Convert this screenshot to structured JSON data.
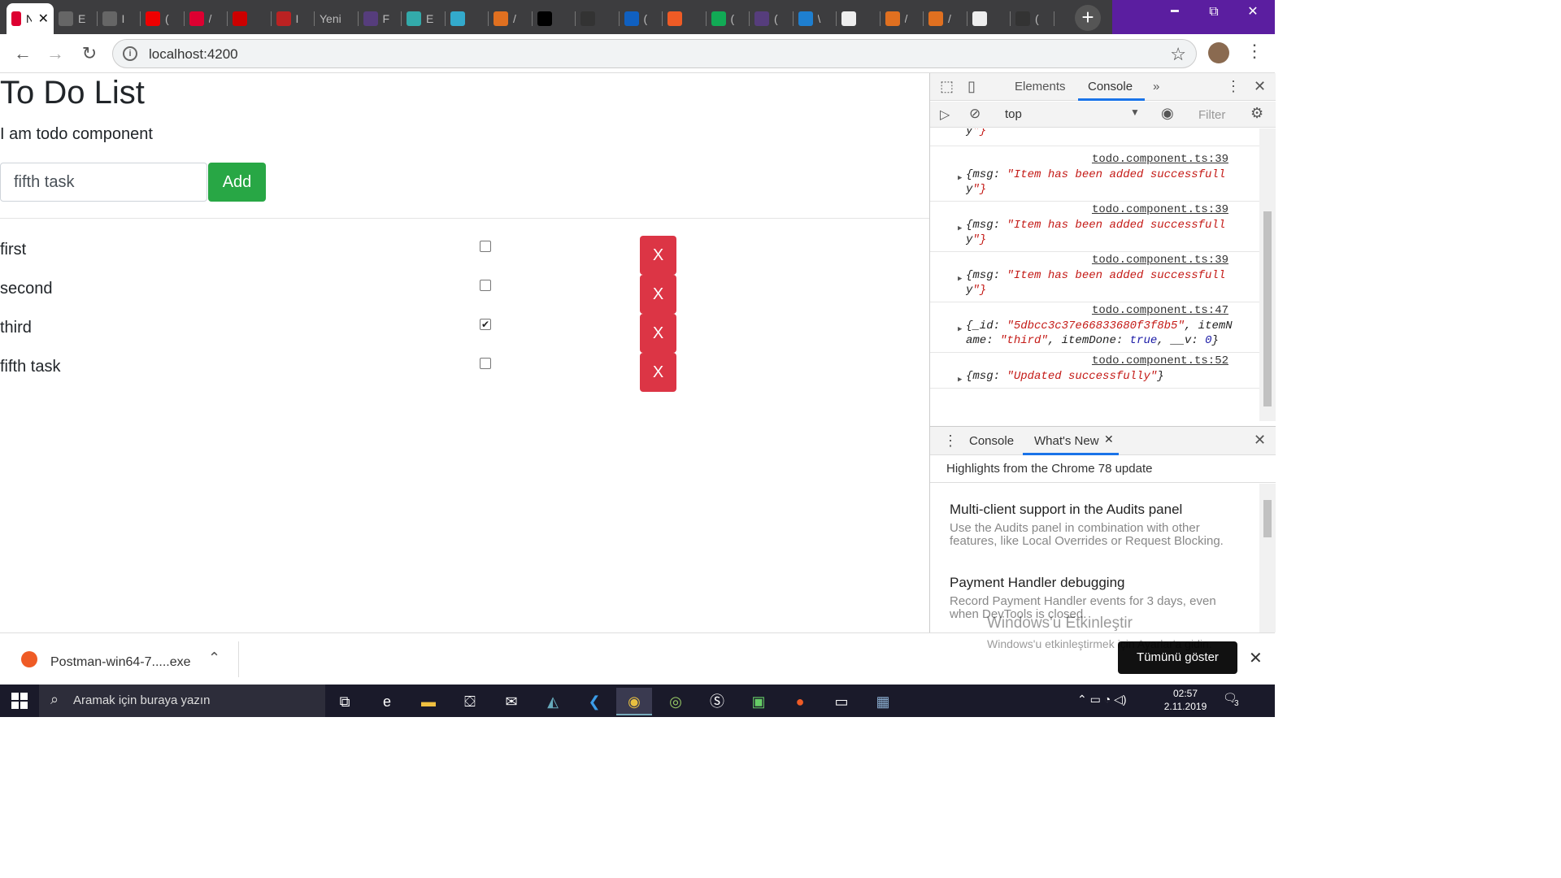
{
  "browser": {
    "tabs": [
      {
        "title": "N",
        "icon": "angular-icon",
        "active": true
      },
      {
        "title": "E",
        "icon": "globe-icon"
      },
      {
        "title": "I",
        "icon": "globe-icon"
      },
      {
        "title": "(",
        "icon": "youtube-icon"
      },
      {
        "title": "/",
        "icon": "angular-logo-icon"
      },
      {
        "title": "",
        "icon": "p-icon"
      },
      {
        "title": "I",
        "icon": "h-icon"
      },
      {
        "title": "Yeni",
        "icon": ""
      },
      {
        "title": "F",
        "icon": "bootstrap-icon"
      },
      {
        "title": "E",
        "icon": "cloud-icon"
      },
      {
        "title": "",
        "icon": "bot-icon"
      },
      {
        "title": "/",
        "icon": "stackoverflow-icon"
      },
      {
        "title": "",
        "icon": "medium-icon"
      },
      {
        "title": "",
        "icon": "github-icon"
      },
      {
        "title": "(",
        "icon": "blue-icon"
      },
      {
        "title": "",
        "icon": "postman-icon"
      },
      {
        "title": "(",
        "icon": "terminal-icon"
      },
      {
        "title": "(",
        "icon": "bootstrap-icon"
      },
      {
        "title": "\\",
        "icon": "vscode-icon"
      },
      {
        "title": "",
        "icon": "google-icon"
      },
      {
        "title": "/",
        "icon": "stackoverflow-icon"
      },
      {
        "title": "/",
        "icon": "stackoverflow-icon"
      },
      {
        "title": "",
        "icon": "google-icon"
      },
      {
        "title": "(",
        "icon": "github-icon"
      }
    ],
    "new_tab_label": "+",
    "window_controls": {
      "minimize": "━",
      "restore": "⧉",
      "close": "✕"
    },
    "url": "localhost:4200"
  },
  "app": {
    "heading": "To Do List",
    "subtitle": "I am todo component",
    "input_value": "fifth task",
    "add_label": "Add",
    "delete_label": "X",
    "items": [
      {
        "name": "first",
        "done": false
      },
      {
        "name": "second",
        "done": false
      },
      {
        "name": "third",
        "done": true
      },
      {
        "name": "fifth task",
        "done": false
      }
    ]
  },
  "devtools": {
    "tabs": [
      "Elements",
      "Console"
    ],
    "more": "»",
    "context": "top",
    "filter_placeholder": "Filter",
    "log": [
      {
        "source": "",
        "lines": [
          "y\"}"
        ]
      },
      {
        "source": "todo.component.ts:39",
        "lines": [
          "{msg: \"Item has been added successfull",
          "y\"}"
        ]
      },
      {
        "source": "todo.component.ts:39",
        "lines": [
          "{msg: \"Item has been added successfull",
          "y\"}"
        ]
      },
      {
        "source": "todo.component.ts:39",
        "lines": [
          "{msg: \"Item has been added successfull",
          "y\"}"
        ]
      },
      {
        "source": "todo.component.ts:47",
        "lines": [
          "{_id: \"5dbcc3c37e66833680f3f8b5\", itemN",
          "ame: \"third\", itemDone: true, __v: 0}"
        ]
      },
      {
        "source": "todo.component.ts:52",
        "lines": [
          "{msg: \"Updated successfully\"}"
        ]
      }
    ],
    "prompt": "›",
    "drawer_tabs": [
      "Console",
      "What's New"
    ],
    "whats_new_header": "Highlights from the Chrome 78 update",
    "whats_new": [
      {
        "title": "Multi-client support in the Audits panel",
        "desc": "Use the Audits panel in combination with other features, like Local Overrides or Request Blocking."
      },
      {
        "title": "Payment Handler debugging",
        "desc": "Record Payment Handler events for 3 days, even when DevTools is closed."
      }
    ]
  },
  "downloads": {
    "file": "Postman-win64-7.....exe",
    "show_all": "Tümünü göster"
  },
  "watermark": {
    "line1": "Windows'u Etkinleştir",
    "line2": "Windows'u etkinleştirmek için Ayarlar'a gidin."
  },
  "taskbar": {
    "search_placeholder": "Aramak için buraya yazın",
    "time": "02:57",
    "date": "2.11.2019",
    "notifications": "3"
  }
}
